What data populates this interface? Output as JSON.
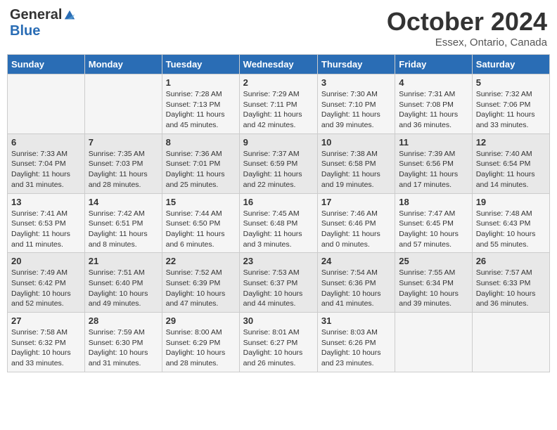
{
  "header": {
    "logo_general": "General",
    "logo_blue": "Blue",
    "month_title": "October 2024",
    "subtitle": "Essex, Ontario, Canada"
  },
  "days_of_week": [
    "Sunday",
    "Monday",
    "Tuesday",
    "Wednesday",
    "Thursday",
    "Friday",
    "Saturday"
  ],
  "weeks": [
    [
      {
        "day": "",
        "content": ""
      },
      {
        "day": "",
        "content": ""
      },
      {
        "day": "1",
        "content": "Sunrise: 7:28 AM\nSunset: 7:13 PM\nDaylight: 11 hours and 45 minutes."
      },
      {
        "day": "2",
        "content": "Sunrise: 7:29 AM\nSunset: 7:11 PM\nDaylight: 11 hours and 42 minutes."
      },
      {
        "day": "3",
        "content": "Sunrise: 7:30 AM\nSunset: 7:10 PM\nDaylight: 11 hours and 39 minutes."
      },
      {
        "day": "4",
        "content": "Sunrise: 7:31 AM\nSunset: 7:08 PM\nDaylight: 11 hours and 36 minutes."
      },
      {
        "day": "5",
        "content": "Sunrise: 7:32 AM\nSunset: 7:06 PM\nDaylight: 11 hours and 33 minutes."
      }
    ],
    [
      {
        "day": "6",
        "content": "Sunrise: 7:33 AM\nSunset: 7:04 PM\nDaylight: 11 hours and 31 minutes."
      },
      {
        "day": "7",
        "content": "Sunrise: 7:35 AM\nSunset: 7:03 PM\nDaylight: 11 hours and 28 minutes."
      },
      {
        "day": "8",
        "content": "Sunrise: 7:36 AM\nSunset: 7:01 PM\nDaylight: 11 hours and 25 minutes."
      },
      {
        "day": "9",
        "content": "Sunrise: 7:37 AM\nSunset: 6:59 PM\nDaylight: 11 hours and 22 minutes."
      },
      {
        "day": "10",
        "content": "Sunrise: 7:38 AM\nSunset: 6:58 PM\nDaylight: 11 hours and 19 minutes."
      },
      {
        "day": "11",
        "content": "Sunrise: 7:39 AM\nSunset: 6:56 PM\nDaylight: 11 hours and 17 minutes."
      },
      {
        "day": "12",
        "content": "Sunrise: 7:40 AM\nSunset: 6:54 PM\nDaylight: 11 hours and 14 minutes."
      }
    ],
    [
      {
        "day": "13",
        "content": "Sunrise: 7:41 AM\nSunset: 6:53 PM\nDaylight: 11 hours and 11 minutes."
      },
      {
        "day": "14",
        "content": "Sunrise: 7:42 AM\nSunset: 6:51 PM\nDaylight: 11 hours and 8 minutes."
      },
      {
        "day": "15",
        "content": "Sunrise: 7:44 AM\nSunset: 6:50 PM\nDaylight: 11 hours and 6 minutes."
      },
      {
        "day": "16",
        "content": "Sunrise: 7:45 AM\nSunset: 6:48 PM\nDaylight: 11 hours and 3 minutes."
      },
      {
        "day": "17",
        "content": "Sunrise: 7:46 AM\nSunset: 6:46 PM\nDaylight: 11 hours and 0 minutes."
      },
      {
        "day": "18",
        "content": "Sunrise: 7:47 AM\nSunset: 6:45 PM\nDaylight: 10 hours and 57 minutes."
      },
      {
        "day": "19",
        "content": "Sunrise: 7:48 AM\nSunset: 6:43 PM\nDaylight: 10 hours and 55 minutes."
      }
    ],
    [
      {
        "day": "20",
        "content": "Sunrise: 7:49 AM\nSunset: 6:42 PM\nDaylight: 10 hours and 52 minutes."
      },
      {
        "day": "21",
        "content": "Sunrise: 7:51 AM\nSunset: 6:40 PM\nDaylight: 10 hours and 49 minutes."
      },
      {
        "day": "22",
        "content": "Sunrise: 7:52 AM\nSunset: 6:39 PM\nDaylight: 10 hours and 47 minutes."
      },
      {
        "day": "23",
        "content": "Sunrise: 7:53 AM\nSunset: 6:37 PM\nDaylight: 10 hours and 44 minutes."
      },
      {
        "day": "24",
        "content": "Sunrise: 7:54 AM\nSunset: 6:36 PM\nDaylight: 10 hours and 41 minutes."
      },
      {
        "day": "25",
        "content": "Sunrise: 7:55 AM\nSunset: 6:34 PM\nDaylight: 10 hours and 39 minutes."
      },
      {
        "day": "26",
        "content": "Sunrise: 7:57 AM\nSunset: 6:33 PM\nDaylight: 10 hours and 36 minutes."
      }
    ],
    [
      {
        "day": "27",
        "content": "Sunrise: 7:58 AM\nSunset: 6:32 PM\nDaylight: 10 hours and 33 minutes."
      },
      {
        "day": "28",
        "content": "Sunrise: 7:59 AM\nSunset: 6:30 PM\nDaylight: 10 hours and 31 minutes."
      },
      {
        "day": "29",
        "content": "Sunrise: 8:00 AM\nSunset: 6:29 PM\nDaylight: 10 hours and 28 minutes."
      },
      {
        "day": "30",
        "content": "Sunrise: 8:01 AM\nSunset: 6:27 PM\nDaylight: 10 hours and 26 minutes."
      },
      {
        "day": "31",
        "content": "Sunrise: 8:03 AM\nSunset: 6:26 PM\nDaylight: 10 hours and 23 minutes."
      },
      {
        "day": "",
        "content": ""
      },
      {
        "day": "",
        "content": ""
      }
    ]
  ]
}
